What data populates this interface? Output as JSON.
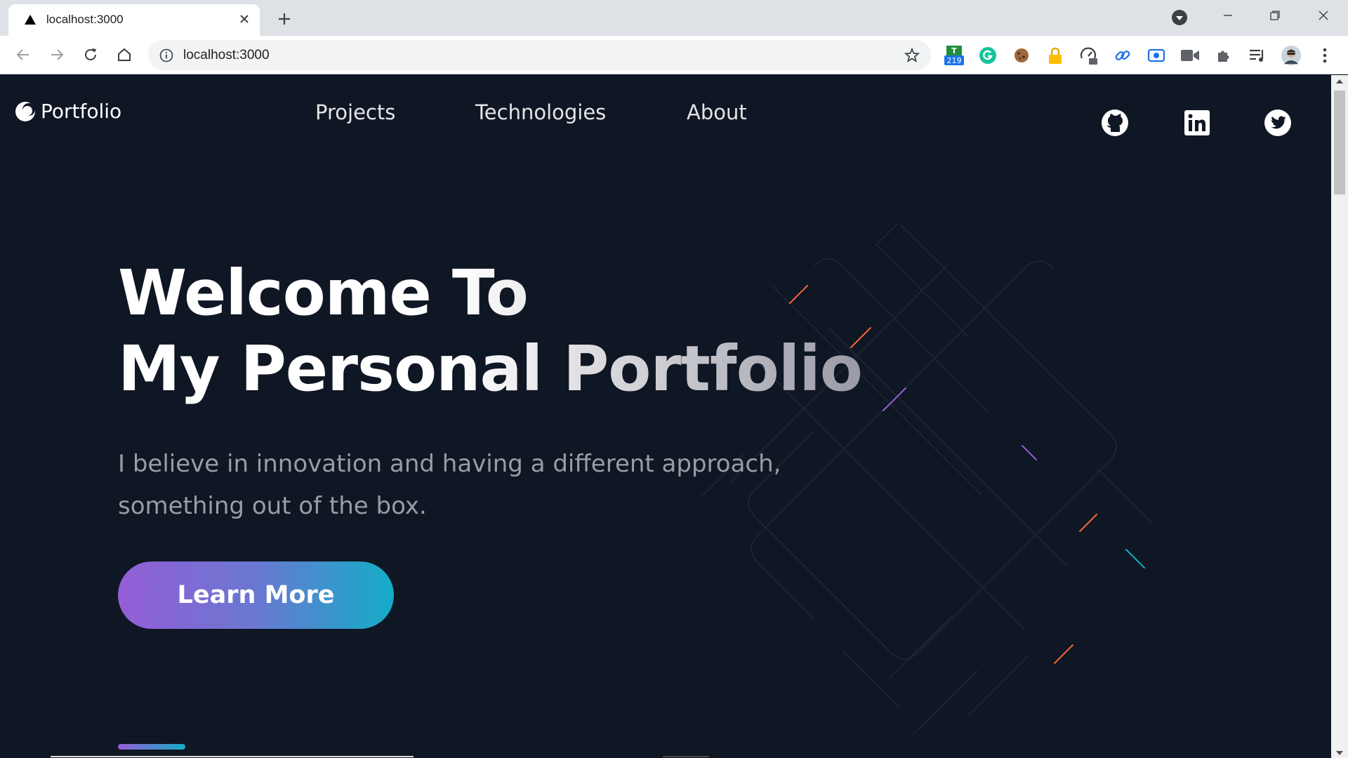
{
  "browser": {
    "tab_title": "localhost:3000",
    "url": "localhost:3000",
    "extensions": [
      {
        "name": "calendar-extension-icon",
        "badge": "219"
      },
      {
        "name": "grammarly-icon"
      },
      {
        "name": "cookie-icon"
      },
      {
        "name": "lock-extension-icon"
      },
      {
        "name": "speed-gauge-icon"
      },
      {
        "name": "link-icon"
      },
      {
        "name": "screen-capture-icon"
      },
      {
        "name": "video-camera-icon"
      },
      {
        "name": "puzzle-extensions-icon"
      },
      {
        "name": "media-queue-icon"
      },
      {
        "name": "profile-avatar"
      },
      {
        "name": "kebab-menu-icon"
      }
    ]
  },
  "nav": {
    "brand": "Portfolio",
    "links": [
      "Projects",
      "Technologies",
      "About"
    ],
    "social": [
      "github-icon",
      "linkedin-icon",
      "twitter-icon"
    ]
  },
  "hero": {
    "title_line1": "Welcome To",
    "title_line2": "My Personal Portfolio",
    "subtitle": "I believe in innovation and having a different approach, something out of the box.",
    "cta": "Learn More"
  },
  "colors": {
    "page_bg": "#0f1624",
    "gradient_start": "#945dd6",
    "gradient_mid": "#6978d1",
    "gradient_end": "#13adc7"
  }
}
